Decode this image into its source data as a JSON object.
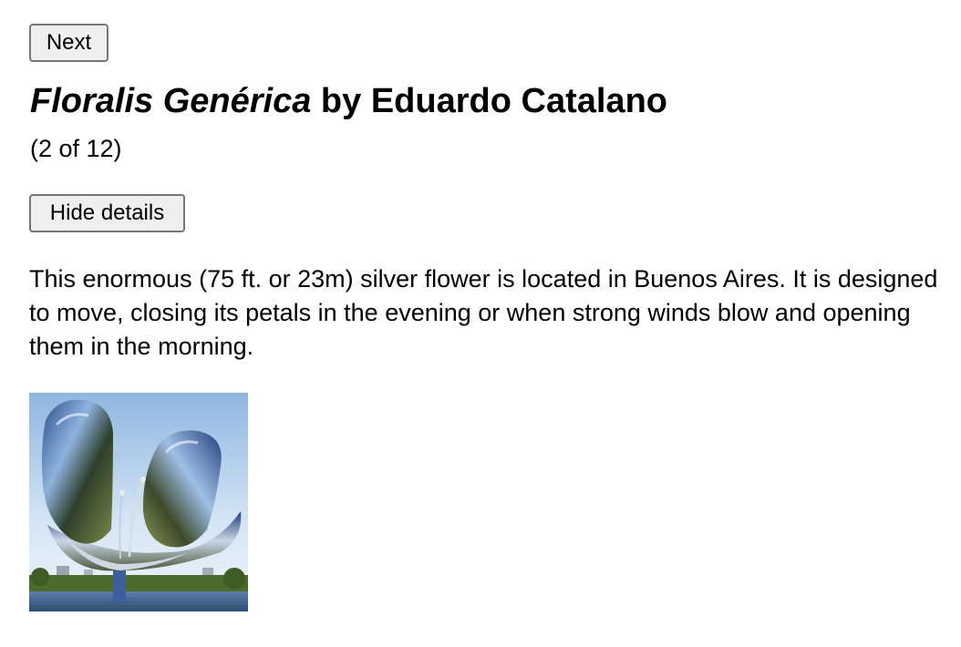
{
  "nav": {
    "next_label": "Next"
  },
  "artwork": {
    "title_italic": "Floralis Genérica",
    "title_rest": " by Eduardo Catalano",
    "counter": "(2 of 12)",
    "toggle_label": "Hide details",
    "description": "This enormous (75 ft. or 23m) silver flower is located in Buenos Aires. It is designed to move, closing its petals in the evening or when strong winds blow and opening them in the morning.",
    "image_subject": "floralis-generica-sculpture"
  },
  "colors": {
    "button_bg": "#efefef",
    "button_border": "#767676",
    "text": "#000000",
    "sky": "#bcd6ee"
  }
}
